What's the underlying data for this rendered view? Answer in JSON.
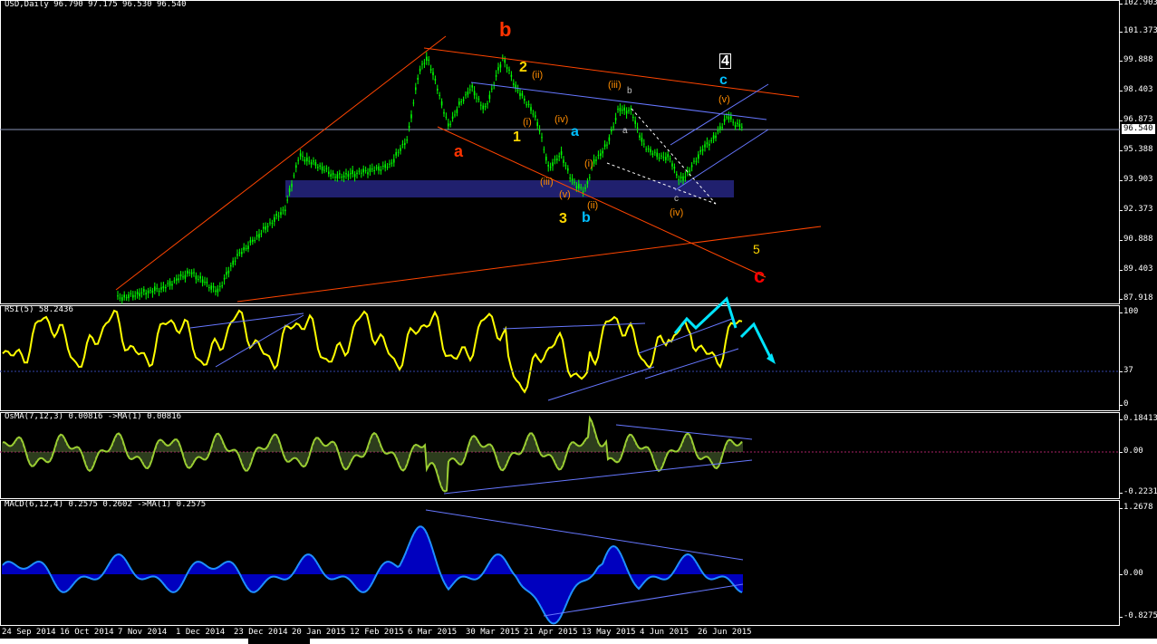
{
  "main": {
    "title": "USD,Daily  96.790 97.175 96.530 96.540",
    "current_price": "96.540",
    "price_axis": [
      "102.903",
      "101.373",
      "99.888",
      "98.403",
      "96.873",
      "95.388",
      "93.903",
      "92.373",
      "90.888",
      "89.403",
      "87.918"
    ],
    "wave_labels_major": [
      {
        "t": "b",
        "c": "#ff3300",
        "s": 22
      },
      {
        "t": "a",
        "c": "#ff3300",
        "s": 18
      },
      {
        "t": "c",
        "c": "#ff0000",
        "s": 22
      },
      {
        "t": "2",
        "c": "#ffd700",
        "s": 16
      },
      {
        "t": "1",
        "c": "#ffd700",
        "s": 16
      },
      {
        "t": "3",
        "c": "#ffd700",
        "s": 16
      },
      {
        "t": "a",
        "c": "#00bfff",
        "s": 16
      },
      {
        "t": "b",
        "c": "#00bfff",
        "s": 16
      },
      {
        "t": "c",
        "c": "#00bfff",
        "s": 16
      },
      {
        "t": "4",
        "c": "#ffffff",
        "s": 16
      },
      {
        "t": "5",
        "c": "#ffd700",
        "s": 14
      }
    ],
    "wave_labels_minor": [
      {
        "t": "(ii)",
        "c": "#ff8c00"
      },
      {
        "t": "(iii)",
        "c": "#ff8c00"
      },
      {
        "t": "(i)",
        "c": "#ff8c00"
      },
      {
        "t": "(iv)",
        "c": "#ff8c00"
      },
      {
        "t": "(iii)",
        "c": "#ff8c00"
      },
      {
        "t": "(v)",
        "c": "#ff8c00"
      },
      {
        "t": "(i)",
        "c": "#ff8c00"
      },
      {
        "t": "(ii)",
        "c": "#ff8c00"
      },
      {
        "t": "(iv)",
        "c": "#ff8c00"
      },
      {
        "t": "(v)",
        "c": "#ff8c00"
      },
      {
        "t": "b",
        "c": "#c0c0c0"
      },
      {
        "t": "a",
        "c": "#c0c0c0"
      },
      {
        "t": "c",
        "c": "#c0c0c0"
      }
    ]
  },
  "rsi": {
    "title": "RSI(5) 58.2436",
    "axis": [
      "100",
      "37",
      "0"
    ]
  },
  "osma": {
    "title": "OsMA(7,12,3) 0.00816  ->MA(1) 0.00816",
    "axis": [
      "0.18413",
      "0.00",
      "-0.22312"
    ]
  },
  "macd": {
    "title": "MACD(6,12,4) 0.2575 0.2602  ->MA(1) 0.2575",
    "axis": [
      "1.2678",
      "0.00",
      "-0.8275"
    ]
  },
  "x_axis": [
    "24 Sep 2014",
    "16 Oct 2014",
    "7 Nov 2014",
    "1 Dec 2014",
    "23 Dec 2014",
    "20 Jan 2015",
    "12 Feb 2015",
    "6 Mar 2015",
    "30 Mar 2015",
    "21 Apr 2015",
    "13 May 2015",
    "4 Jun 2015",
    "26 Jun 2015"
  ],
  "colors": {
    "candle": "#00ff00",
    "rsi_line": "#ffff00",
    "osma": "#9acd32",
    "macd_line": "#1e90ff",
    "macd_hist": "#0000ff",
    "trendline": "#ff4500",
    "channel": "#6677ff",
    "zone": "#20206e",
    "arrows": "#00e5ff"
  }
}
